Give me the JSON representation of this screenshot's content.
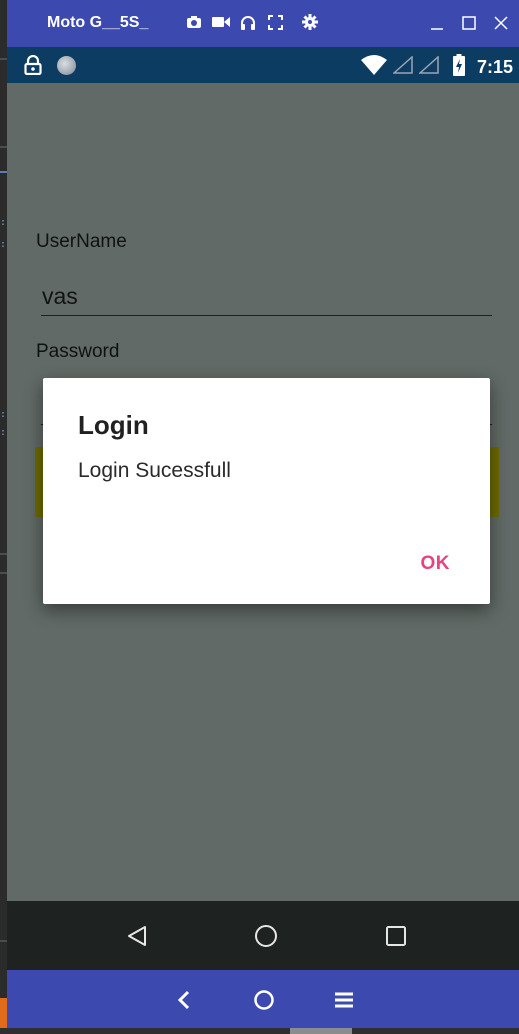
{
  "emulator": {
    "device_name": "Moto G__5S_",
    "toolbar_icons": [
      "camera-icon",
      "video-icon",
      "headphones-icon",
      "fullscreen-icon",
      "settings-icon"
    ],
    "window_controls": [
      "minimize-icon",
      "maximize-icon",
      "close-icon"
    ],
    "bottom_controls": [
      "back-chevron-icon",
      "home-circle-icon",
      "menu-icon"
    ],
    "accent_color": "#3c4ab0"
  },
  "status_bar": {
    "left_icons": [
      "lock-icon",
      "notification-dot-icon"
    ],
    "right_icons": [
      "wifi-icon",
      "signal-icon",
      "signal-icon",
      "battery-charging-icon"
    ],
    "time": "7:15",
    "color": "#0d3c63"
  },
  "app": {
    "username_label": "UserName",
    "username_value": "vas",
    "password_label": "Password",
    "password_value": ""
  },
  "dialog": {
    "title": "Login",
    "message": "Login Sucessfull",
    "ok_label": "OK",
    "ok_color": "#e8437f"
  },
  "nav_bar": {
    "buttons": [
      "back-triangle-icon",
      "home-circle-icon",
      "recents-square-icon"
    ]
  }
}
